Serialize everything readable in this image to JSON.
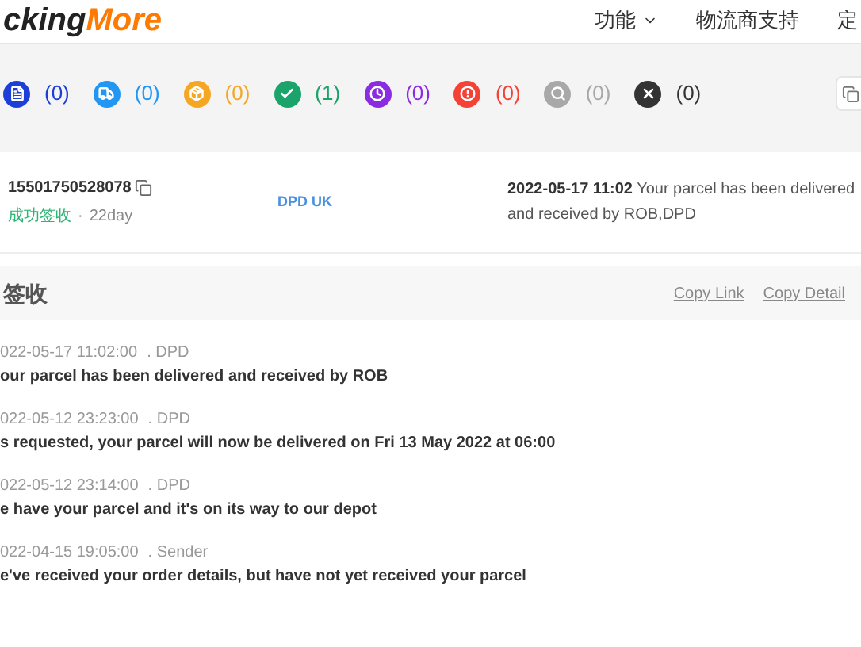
{
  "header": {
    "logo": {
      "dark": "cking",
      "accent": "More"
    },
    "nav": [
      {
        "label": "功能",
        "dropdown": true
      },
      {
        "label": "物流商支持",
        "dropdown": false
      },
      {
        "label": "定",
        "dropdown": false
      }
    ]
  },
  "status_filters": [
    {
      "kind": "info",
      "count": "(0)",
      "color": "#1d3fd8"
    },
    {
      "kind": "transit",
      "count": "(0)",
      "color": "#2196f3"
    },
    {
      "kind": "pickup",
      "count": "(0)",
      "color": "#f5a623"
    },
    {
      "kind": "delivered",
      "count": "(1)",
      "color": "#1aa36a"
    },
    {
      "kind": "expired",
      "count": "(0)",
      "color": "#8b2be2"
    },
    {
      "kind": "alert",
      "count": "(0)",
      "color": "#f44336"
    },
    {
      "kind": "notfound",
      "count": "(0)",
      "color": "#a8a8a8"
    },
    {
      "kind": "failed",
      "count": "(0)",
      "color": "#333333"
    }
  ],
  "shipment": {
    "number": "15501750528078",
    "status": "成功签收",
    "separator": "·",
    "age": "22day",
    "carrier": "DPD UK",
    "latest_time": "2022-05-17 11:02",
    "latest_text": "Your parcel has been delivered and received by ROB,DPD"
  },
  "detail": {
    "heading": "签收",
    "actions": [
      "Copy Link",
      "Copy Detail"
    ],
    "events": [
      {
        "time": "022-05-17 11:02:00",
        "source": ". DPD",
        "description": "our parcel has been delivered and received by ROB"
      },
      {
        "time": "022-05-12 23:23:00",
        "source": ". DPD",
        "description": "s requested, your parcel will now be delivered on Fri 13 May 2022 at 06:00"
      },
      {
        "time": "022-05-12 23:14:00",
        "source": ". DPD",
        "description": "e have your parcel and it's on its way to our depot"
      },
      {
        "time": "022-04-15 19:05:00",
        "source": ". Sender",
        "description": "e've received your order details, but have not yet received your parcel"
      }
    ]
  }
}
